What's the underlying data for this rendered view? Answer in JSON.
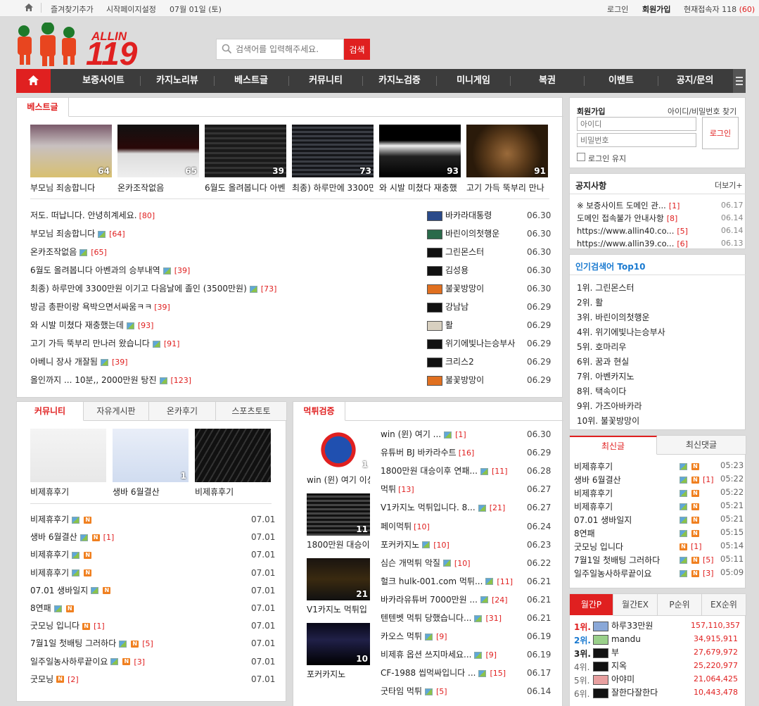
{
  "topbar": {
    "bookmark": "즐겨찾기추가",
    "startpage": "시작페이지설정",
    "date": "07월 01일 (토)",
    "login": "로그인",
    "join": "회원가입",
    "online_label": "현재접속자 118",
    "online_count": "(60)"
  },
  "header": {
    "logo_text": "ALLIN",
    "logo_num": "119",
    "search_placeholder": "검색어를 입력해주세요.",
    "search_button": "검색"
  },
  "nav": [
    "보증사이트",
    "카지노리뷰",
    "베스트글",
    "커뮤니티",
    "카지노검증",
    "미니게임",
    "복권",
    "이벤트",
    "공지/문의"
  ],
  "best": {
    "tab": "베스트글",
    "thumbs": [
      {
        "title": "부모님 죄송합니다",
        "count": "64"
      },
      {
        "title": "온카조작없음",
        "count": "65"
      },
      {
        "title": "6월도 올려봅니다 아벤",
        "count": "39"
      },
      {
        "title": "최종) 하루만에 3300만",
        "count": "73"
      },
      {
        "title": "와 시발 미쳤다 재충했",
        "count": "93"
      },
      {
        "title": "고기 가득 뚝부리 만나",
        "count": "91"
      }
    ],
    "list": [
      {
        "title": "저도. 떠납니다. 안녕히계세요.",
        "img": false,
        "c": "[80]",
        "user": "바카라대통령",
        "date": "06.30"
      },
      {
        "title": "부모님 죄송합니다",
        "img": true,
        "c": "[64]",
        "user": "바린이의첫행운",
        "date": "06.30"
      },
      {
        "title": "온카조작없음",
        "img": true,
        "c": "[65]",
        "user": "그린몬스터",
        "date": "06.30"
      },
      {
        "title": "6월도 올려봅니다 아벤과의 승부내역",
        "img": true,
        "c": "[39]",
        "user": "김성용",
        "date": "06.30"
      },
      {
        "title": "최종) 하루만에 3300만원 이기고 다음날에 졸인 (3500만원)",
        "img": true,
        "c": "[73]",
        "user": "불꽃방망이",
        "date": "06.30"
      },
      {
        "title": "방금 총판이랑 욕박으면서싸움ㅋㅋ",
        "img": false,
        "c": "[39]",
        "user": "강남남",
        "date": "06.29"
      },
      {
        "title": "와 시발 미쳤다 재충했는데",
        "img": true,
        "c": "[93]",
        "user": "활",
        "date": "06.29"
      },
      {
        "title": "고기 가득 뚝부리 만나러 왔습니다",
        "img": true,
        "c": "[91]",
        "user": "위기에빛나는승부사",
        "date": "06.29"
      },
      {
        "title": "아베니 장사 개잘됨",
        "img": true,
        "c": "[39]",
        "user": "크리스2",
        "date": "06.29"
      },
      {
        "title": "올인까지 ... 10분,, 2000만원 탕진",
        "img": true,
        "c": "[123]",
        "user": "불꽃방망이",
        "date": "06.29"
      }
    ]
  },
  "community": {
    "tabs": [
      "커뮤니티",
      "자유게시판",
      "온카후기",
      "스포츠토토"
    ],
    "thumbs": [
      {
        "title": "비제휴후기",
        "count": ""
      },
      {
        "title": "생바 6월결산",
        "count": "1"
      },
      {
        "title": "비제휴후기",
        "count": ""
      }
    ],
    "list": [
      {
        "title": "비제휴후기",
        "img": true,
        "n": true,
        "c": "",
        "date": "07.01"
      },
      {
        "title": "생바 6월결산",
        "img": true,
        "n": true,
        "c": "[1]",
        "date": "07.01"
      },
      {
        "title": "비제휴후기",
        "img": true,
        "n": true,
        "c": "",
        "date": "07.01"
      },
      {
        "title": "비제휴후기",
        "img": true,
        "n": true,
        "c": "",
        "date": "07.01"
      },
      {
        "title": "07.01 생바일지",
        "img": true,
        "n": true,
        "c": "",
        "date": "07.01"
      },
      {
        "title": "8연패",
        "img": true,
        "n": true,
        "c": "",
        "date": "07.01"
      },
      {
        "title": "굿모닝 입니다",
        "img": false,
        "n": true,
        "c": "[1]",
        "date": "07.01"
      },
      {
        "title": "7월1일 첫배팅 그러하다",
        "img": true,
        "n": true,
        "c": "[5]",
        "date": "07.01"
      },
      {
        "title": "일주일농사하루끝이요",
        "img": true,
        "n": true,
        "c": "[3]",
        "date": "07.01"
      },
      {
        "title": "굿모닝",
        "img": false,
        "n": true,
        "c": "[2]",
        "date": "07.01"
      }
    ]
  },
  "verify": {
    "tab": "먹튀검증",
    "thumbs": [
      {
        "title": "win (윈) 여기 이상",
        "count": "1"
      },
      {
        "title": "1800만원 대승이",
        "count": "11"
      },
      {
        "title": "V1카지노 먹튀입",
        "count": "21"
      },
      {
        "title": "포커카지노",
        "count": "10"
      }
    ],
    "list": [
      {
        "title": "win (윈) 여기 ...",
        "img": true,
        "c": "[1]",
        "date": "06.30"
      },
      {
        "title": "유튜버 BJ 바카라수트",
        "img": false,
        "c": "[16]",
        "date": "06.29"
      },
      {
        "title": "1800만원 대승이후 연패...",
        "img": true,
        "c": "[11]",
        "date": "06.28"
      },
      {
        "title": "먹튀",
        "img": false,
        "c": "[13]",
        "date": "06.27"
      },
      {
        "title": "V1카지노 먹튀입니다. 8...",
        "img": true,
        "c": "[21]",
        "date": "06.27"
      },
      {
        "title": "페이먹튀",
        "img": false,
        "c": "[10]",
        "date": "06.24"
      },
      {
        "title": "포커카지노",
        "img": true,
        "c": "[10]",
        "date": "06.23"
      },
      {
        "title": "심슨 개먹튀 악질",
        "img": true,
        "c": "[10]",
        "date": "06.22"
      },
      {
        "title": "헐크 hulk-001.com 먹튀...",
        "img": true,
        "c": "[11]",
        "date": "06.21"
      },
      {
        "title": "바카라유튜버 7000만원 ...",
        "img": true,
        "c": "[24]",
        "date": "06.21"
      },
      {
        "title": "텐텐벳 먹튀 당했습니다...",
        "img": true,
        "c": "[31]",
        "date": "06.21"
      },
      {
        "title": "카오스 먹튀",
        "img": true,
        "c": "[9]",
        "date": "06.19"
      },
      {
        "title": "비제휴 옵션 쓰지마세요...",
        "img": true,
        "c": "[9]",
        "date": "06.19"
      },
      {
        "title": "CF-1988 씹먹싸입니다 ...",
        "img": true,
        "c": "[15]",
        "date": "06.17"
      },
      {
        "title": "굿타임 먹튀",
        "img": true,
        "c": "[5]",
        "date": "06.14"
      }
    ]
  },
  "login": {
    "title": "회원가입",
    "find": "아이디/비밀번호 찾기",
    "id_ph": "아이디",
    "pw_ph": "비밀번호",
    "button": "로그인",
    "keep": "로그인 유지"
  },
  "notice": {
    "title": "공지사항",
    "more": "더보기+",
    "list": [
      {
        "title": "※ 보증사이트 도메인 관...",
        "c": "[1]",
        "date": "06.17"
      },
      {
        "title": "도메인 접속불가 안내사항",
        "c": "[8]",
        "date": "06.14"
      },
      {
        "title": "https://www.allin40.co...",
        "c": "[5]",
        "date": "06.14"
      },
      {
        "title": "https://www.allin39.co...",
        "c": "[6]",
        "date": "06.13"
      }
    ]
  },
  "popular": {
    "title": "인기검색어 Top10",
    "list": [
      "1위. 그린몬스터",
      "2위. 활",
      "3위. 바린이의첫행운",
      "4위. 위기에빛나는승부사",
      "5위. 호마리우",
      "6위. 꿈과 현실",
      "7위. 아벤카지노",
      "8위. 택속이다",
      "9위. 가즈아바카라",
      "10위. 불꽃방망이"
    ]
  },
  "recent": {
    "tabs": [
      "최신글",
      "최신댓글"
    ],
    "list": [
      {
        "title": "비제휴후기",
        "img": true,
        "c": "",
        "time": "05:23"
      },
      {
        "title": "생바 6월결산",
        "img": true,
        "c": "[1]",
        "time": "05:22"
      },
      {
        "title": "비제휴후기",
        "img": true,
        "c": "",
        "time": "05:22"
      },
      {
        "title": "비제휴후기",
        "img": true,
        "c": "",
        "time": "05:21"
      },
      {
        "title": "07.01 생바일지",
        "img": true,
        "c": "",
        "time": "05:21"
      },
      {
        "title": "8연패",
        "img": true,
        "c": "",
        "time": "05:15"
      },
      {
        "title": "굿모닝 입니다",
        "img": false,
        "c": "[1]",
        "time": "05:14"
      },
      {
        "title": "7월1일 첫배팅 그러하다",
        "img": true,
        "c": "[5]",
        "time": "05:11"
      },
      {
        "title": "일주일농사하루끝이요",
        "img": true,
        "c": "[3]",
        "time": "05:09"
      }
    ]
  },
  "ranking": {
    "tabs": [
      "월간P",
      "월간EX",
      "P순위",
      "EX순위"
    ],
    "list": [
      {
        "rank": "1위.",
        "name": "하루33만원",
        "value": "157,110,357"
      },
      {
        "rank": "2위.",
        "name": "mandu",
        "value": "34,915,911"
      },
      {
        "rank": "3위.",
        "name": "부",
        "value": "27,679,972"
      },
      {
        "rank": "4위.",
        "name": "지옥",
        "value": "25,220,977"
      },
      {
        "rank": "5위.",
        "name": "아야미",
        "value": "21,064,425"
      },
      {
        "rank": "6위.",
        "name": "잘한다잘한다",
        "value": "10,443,478"
      }
    ]
  }
}
